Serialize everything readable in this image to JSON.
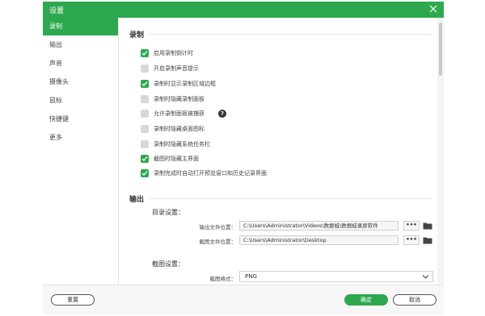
{
  "window": {
    "title": "设置"
  },
  "sidebar": {
    "items": [
      {
        "label": "录制"
      },
      {
        "label": "输出"
      },
      {
        "label": "声音"
      },
      {
        "label": "摄像头"
      },
      {
        "label": "鼠标"
      },
      {
        "label": "快捷键"
      },
      {
        "label": "更多"
      }
    ],
    "active_index": 0
  },
  "recording": {
    "title": "录制",
    "options": [
      {
        "label": "启用录制倒计时",
        "checked": true
      },
      {
        "label": "开启录制声音提示",
        "checked": false
      },
      {
        "label": "录制时显示录制区域边框",
        "checked": true
      },
      {
        "label": "录制时隐藏录制面板",
        "checked": false
      },
      {
        "label": "允许录制面板被捕获",
        "checked": false,
        "help": "?"
      },
      {
        "label": "录制时隐藏桌面图标",
        "checked": false
      },
      {
        "label": "录制时隐藏系统任务栏",
        "checked": false
      },
      {
        "label": "截图时隐藏主界面",
        "checked": true
      },
      {
        "label": "录制完成时自动打开预览窗口和历史记录界面",
        "checked": true
      }
    ]
  },
  "output": {
    "title": "输出",
    "directory_title": "目录设置：",
    "output_location_label": "输出文件位置：",
    "output_location_value": "C:\\Users\\Administrator\\Videos\\数据蛙\\数据蛙录屏软件",
    "screenshot_location_label": "截图文件位置：",
    "screenshot_location_value": "C:\\Users\\Administrator\\Desktop",
    "browse_label": "•••",
    "screenshot_title": "截图设置：",
    "format_label": "截图格式：",
    "format_value": "PNG"
  },
  "footer": {
    "reset_label": "重置",
    "ok_label": "确定",
    "cancel_label": "取消"
  },
  "colors": {
    "accent": "#2ea84f",
    "unchecked": "#d8d8d8"
  }
}
